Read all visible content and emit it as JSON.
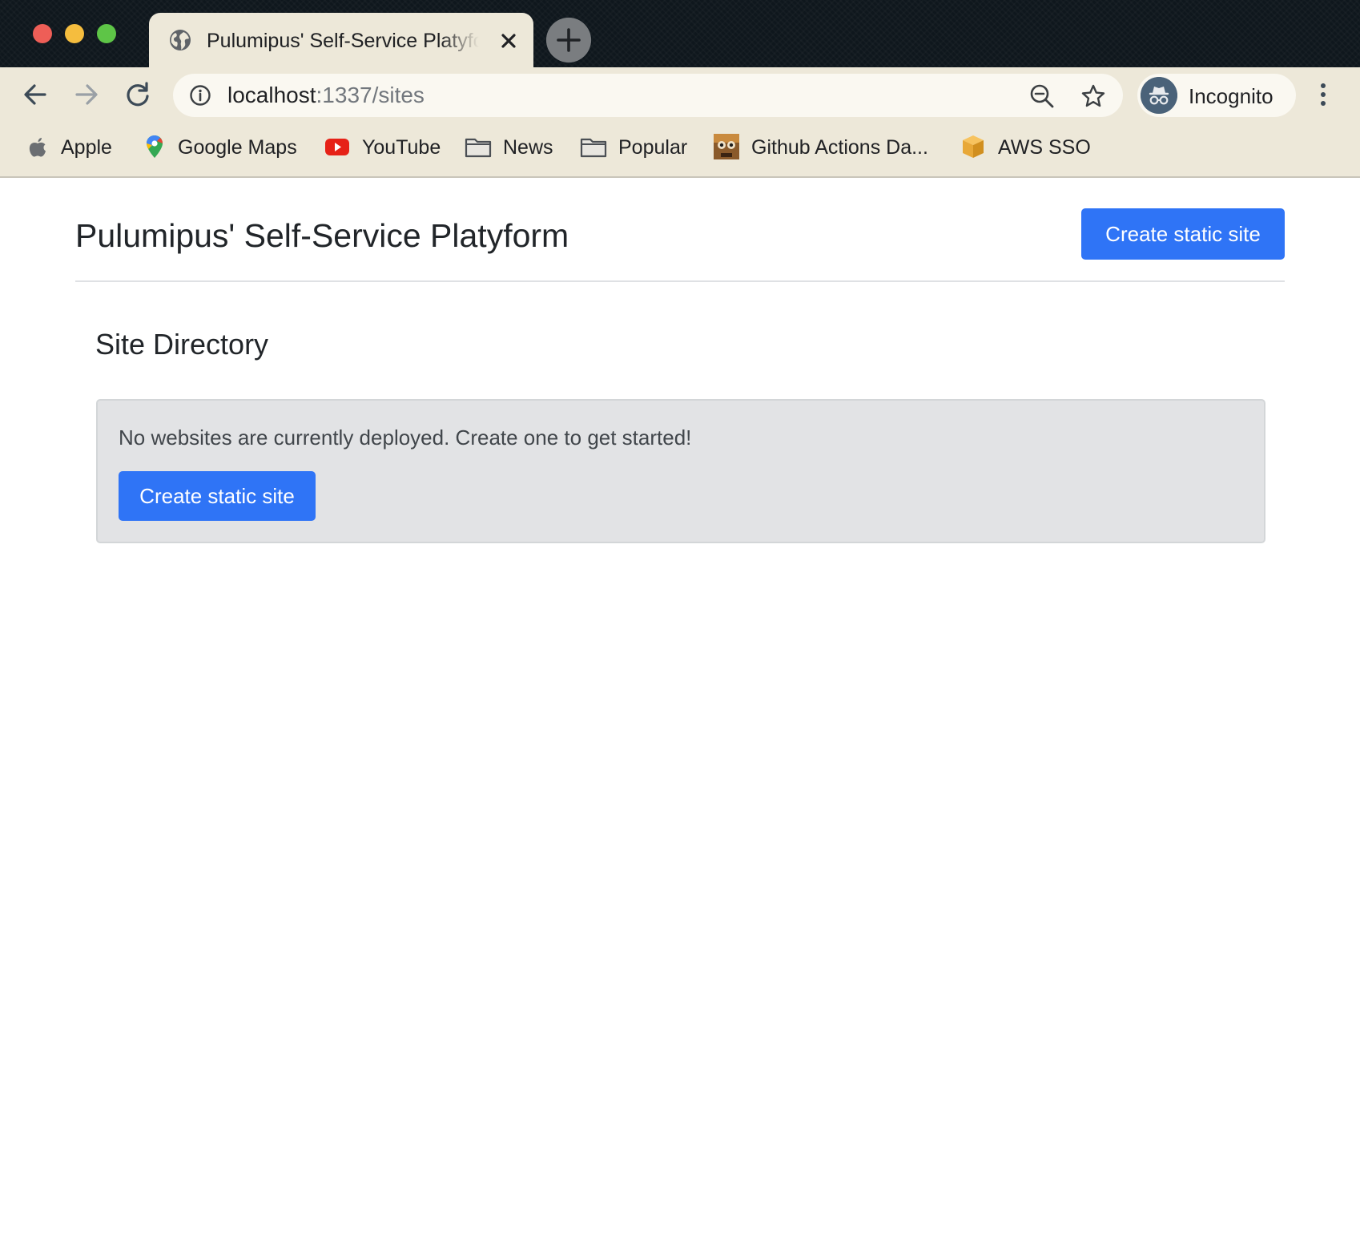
{
  "browser": {
    "tab": {
      "title": "Pulumipus' Self-Service Platyform"
    },
    "address_bar": {
      "host": "localhost",
      "path": ":1337/sites"
    },
    "profile": {
      "label": "Incognito"
    },
    "bookmarks": [
      {
        "label": "Apple",
        "icon": "apple-icon"
      },
      {
        "label": "Google Maps",
        "icon": "google-maps-icon"
      },
      {
        "label": "YouTube",
        "icon": "youtube-icon"
      },
      {
        "label": "News",
        "icon": "folder-icon"
      },
      {
        "label": "Popular",
        "icon": "folder-icon"
      },
      {
        "label": "Github Actions Da...",
        "icon": "github-actions-icon"
      },
      {
        "label": "AWS SSO",
        "icon": "aws-cube-icon"
      }
    ]
  },
  "page": {
    "title": "Pulumipus' Self-Service Platyform",
    "header_button_label": "Create static site",
    "section_title": "Site Directory",
    "empty_state": {
      "message": "No websites are currently deployed. Create one to get started!",
      "button_label": "Create static site"
    }
  },
  "colors": {
    "primary_button": "#2f74f6",
    "chrome_frame": "#ede8d9",
    "tabstrip_background": "#0f171d",
    "empty_panel": "#e2e3e5"
  }
}
